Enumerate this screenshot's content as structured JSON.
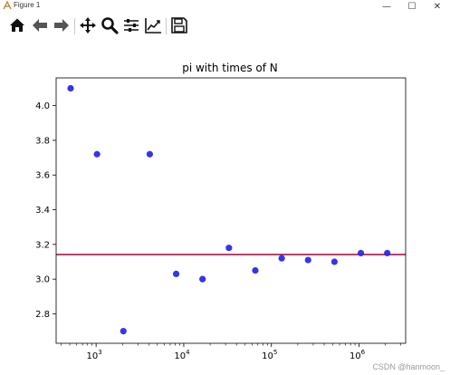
{
  "window": {
    "title": "Figure 1",
    "minimize_glyph": "—",
    "maximize_glyph": "☐",
    "close_glyph": "✕"
  },
  "toolbar": {
    "tools": [
      {
        "name": "home-icon",
        "label": "Home"
      },
      {
        "name": "back-arrow-icon",
        "label": "Back"
      },
      {
        "name": "forward-arrow-icon",
        "label": "Forward"
      },
      {
        "name": "pan-move-icon",
        "label": "Pan"
      },
      {
        "name": "zoom-magnifier-icon",
        "label": "Zoom"
      },
      {
        "name": "subplots-sliders-icon",
        "label": "Configure subplots"
      },
      {
        "name": "edit-axes-icon",
        "label": "Edit axis"
      },
      {
        "name": "save-floppy-icon",
        "label": "Save"
      }
    ]
  },
  "chart_data": {
    "type": "scatter",
    "title": "pi with times of N",
    "xlabel": "",
    "ylabel": "",
    "xscale": "log",
    "xlim": [
      350,
      3400000
    ],
    "ylim": [
      2.63,
      4.16
    ],
    "x_ticks": [
      {
        "value": 1000,
        "base": "10",
        "exp": "3"
      },
      {
        "value": 10000,
        "base": "10",
        "exp": "4"
      },
      {
        "value": 100000,
        "base": "10",
        "exp": "5"
      },
      {
        "value": 1000000,
        "base": "10",
        "exp": "6"
      }
    ],
    "y_ticks": [
      2.8,
      3.0,
      3.2,
      3.4,
      3.6,
      3.8,
      4.0
    ],
    "y_tick_labels": [
      "2.8",
      "3.0",
      "3.2",
      "3.4",
      "3.6",
      "3.8",
      "4.0"
    ],
    "points": [
      {
        "x": 512,
        "y": 4.1
      },
      {
        "x": 1024,
        "y": 3.72
      },
      {
        "x": 2048,
        "y": 2.7
      },
      {
        "x": 4096,
        "y": 3.72
      },
      {
        "x": 8192,
        "y": 3.03
      },
      {
        "x": 16384,
        "y": 3.0
      },
      {
        "x": 32768,
        "y": 3.18
      },
      {
        "x": 65536,
        "y": 3.05
      },
      {
        "x": 131072,
        "y": 3.12
      },
      {
        "x": 262144,
        "y": 3.11
      },
      {
        "x": 524288,
        "y": 3.1
      },
      {
        "x": 1048576,
        "y": 3.15
      },
      {
        "x": 2097152,
        "y": 3.15
      }
    ],
    "reference_line": {
      "y": 3.14159
    },
    "point_color": "#2a2ae8",
    "line_color": "#a0003c",
    "grid": false
  },
  "watermark": "CSDN @hanmoon_"
}
